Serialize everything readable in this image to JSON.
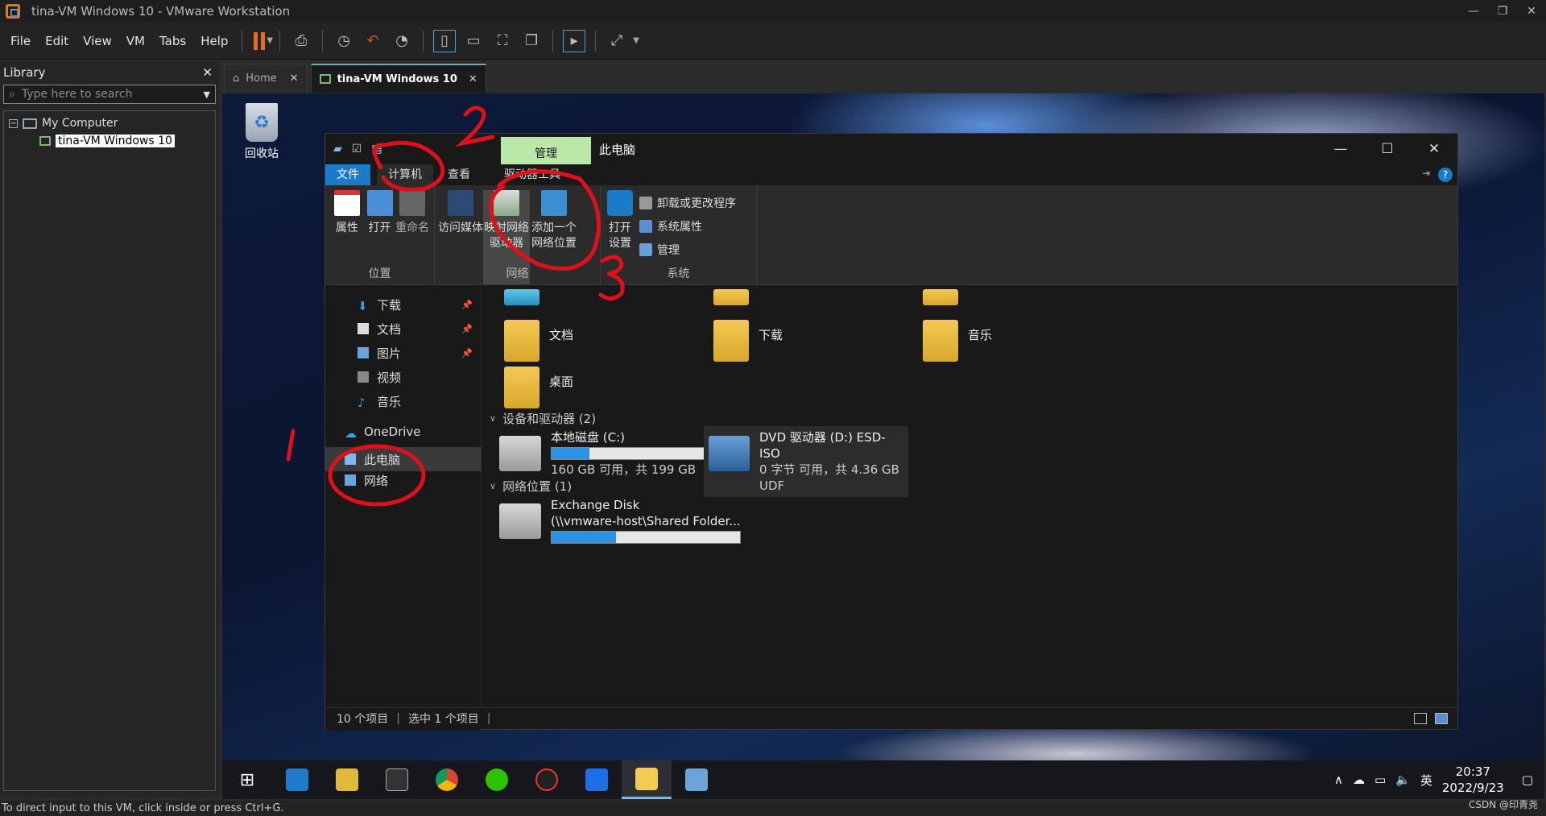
{
  "titlebar": {
    "title": "tina-VM Windows 10 - VMware Workstation",
    "minimize": "—",
    "restore": "❐",
    "close": "✕"
  },
  "menu": [
    "File",
    "Edit",
    "View",
    "VM",
    "Tabs",
    "Help"
  ],
  "library": {
    "title": "Library",
    "close": "✕",
    "search_placeholder": "Type here to search",
    "tree": {
      "root": "My Computer",
      "vm": "tina-VM Windows 10"
    }
  },
  "vm_tabs": [
    {
      "label": "Home",
      "close": "✕"
    },
    {
      "label": "tina-VM Windows 10",
      "close": "✕"
    }
  ],
  "desktop": {
    "recycle_bin": "回收站"
  },
  "explorer": {
    "manage_tab": "管理",
    "title": "此电脑",
    "ribbon_tabs": [
      "文件",
      "计算机",
      "查看",
      "驱动器工具"
    ],
    "groups": {
      "location": {
        "name": "位置",
        "buttons": [
          "属性",
          "打开",
          "重命名"
        ]
      },
      "network": {
        "name": "网络",
        "buttons": [
          "访问媒体",
          "映射网络驱动器",
          "添加一个网络位置"
        ],
        "access": "访问",
        "access2": "媒体",
        "map1": "映射网络",
        "map2": "驱动器",
        "add1": "添加一个",
        "add2": "网络位置"
      },
      "system": {
        "name": "系统",
        "open1": "打开",
        "open2": "设置",
        "items": [
          "卸载或更改程序",
          "系统属性",
          "管理"
        ]
      }
    },
    "nav": {
      "quick": [
        "下载",
        "文档",
        "图片",
        "视频",
        "音乐"
      ],
      "onedrive": "OneDrive",
      "this_pc": "此电脑",
      "network": "网络"
    },
    "folders": [
      "文档",
      "下载",
      "音乐",
      "桌面"
    ],
    "devices_header": "设备和驱动器 (2)",
    "drives": [
      {
        "name": "本地磁盘 (C:)",
        "info": "160 GB 可用，共 199 GB",
        "used_fraction": 0.2
      },
      {
        "name": "DVD 驱动器 (D:) ESD-ISO",
        "info": "0 字节 可用，共 4.36 GB",
        "fs": "UDF"
      }
    ],
    "net_header": "网络位置 (1)",
    "net_location": {
      "name": "Exchange Disk",
      "path": "(\\\\vmware-host\\Shared Folder...",
      "used_fraction": 0.34
    },
    "status": {
      "items": "10 个项目",
      "selected": "选中 1 个项目"
    }
  },
  "taskbar": {
    "ime": "英",
    "time": "20:37",
    "date": "2022/9/23"
  },
  "vm_status": "To direct input to this VM, click inside or press Ctrl+G.",
  "watermark": "CSDN @印青尧",
  "annotations": [
    "1",
    "2",
    "3"
  ],
  "colors": {
    "accent": "#1a7cc8",
    "manage": "#b9e8a9",
    "pause": "#e86c1c",
    "annotation": "#e0101a"
  }
}
